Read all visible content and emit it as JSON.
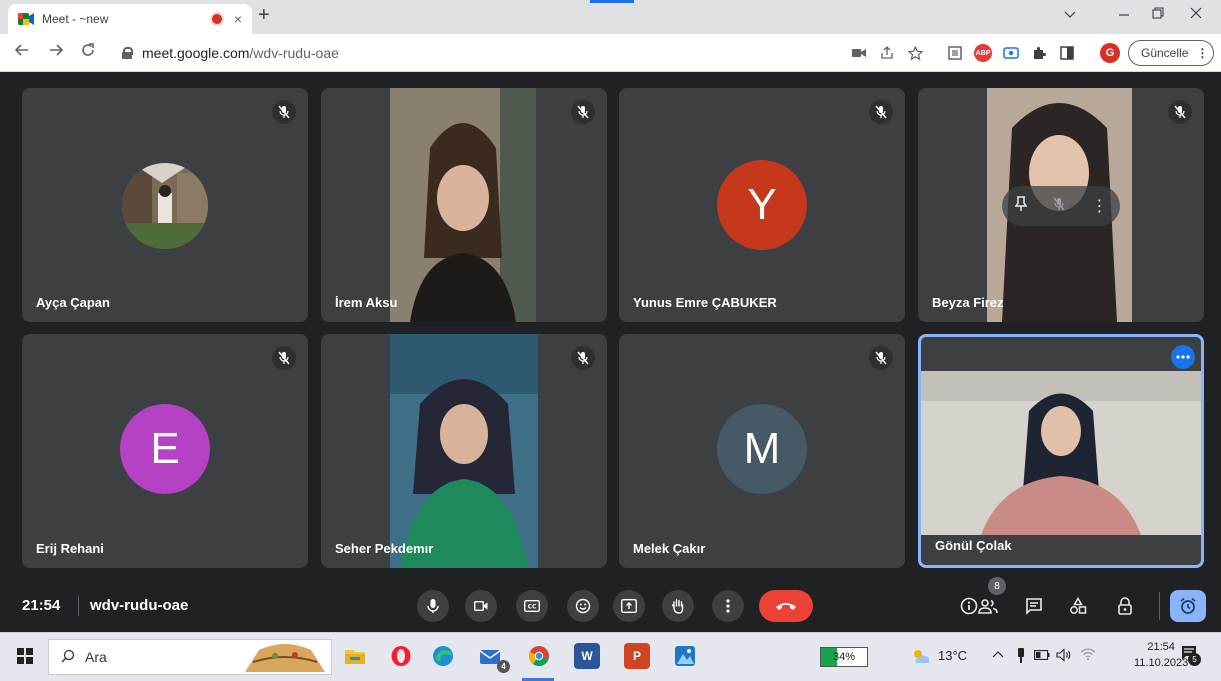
{
  "browser": {
    "tab_title": "Meet - ~new",
    "tab_close": "×",
    "new_tab": "+",
    "address_host": "meet.google.com",
    "address_path": "/wdv-rudu-oae",
    "update_label": "Güncelle",
    "profile_initial": "G",
    "abp_label": "ABP"
  },
  "participants": [
    {
      "name": "Ayça Çapan",
      "type": "photo"
    },
    {
      "name": "İrem Aksu",
      "type": "video"
    },
    {
      "name": "Yunus Emre ÇABUKER",
      "type": "letter",
      "letter": "Y",
      "color": "#c5381b"
    },
    {
      "name": "Beyza Firez",
      "type": "video"
    },
    {
      "name": "Erij Rehani",
      "type": "letter",
      "letter": "E",
      "color": "#b541c4"
    },
    {
      "name": "Seher Pekdemır",
      "type": "video"
    },
    {
      "name": "Melek Çakır",
      "type": "letter",
      "letter": "M",
      "color": "#455a64"
    },
    {
      "name": "Gönül Çolak",
      "type": "video",
      "active": true
    }
  ],
  "meeting": {
    "time": "21:54",
    "code": "wdv-rudu-oae",
    "people_count": "8"
  },
  "taskbar": {
    "search_placeholder": "Ara",
    "mail_badge": "4",
    "battery": "34%",
    "battery_level": 0.34,
    "temperature": "13°C",
    "time": "21:54",
    "date": "11.10.2023",
    "notifications": "5"
  },
  "colors": {
    "accent": "#8ab4f8",
    "hangup": "#ea4335",
    "tile": "#3c4043",
    "background": "#202124"
  }
}
